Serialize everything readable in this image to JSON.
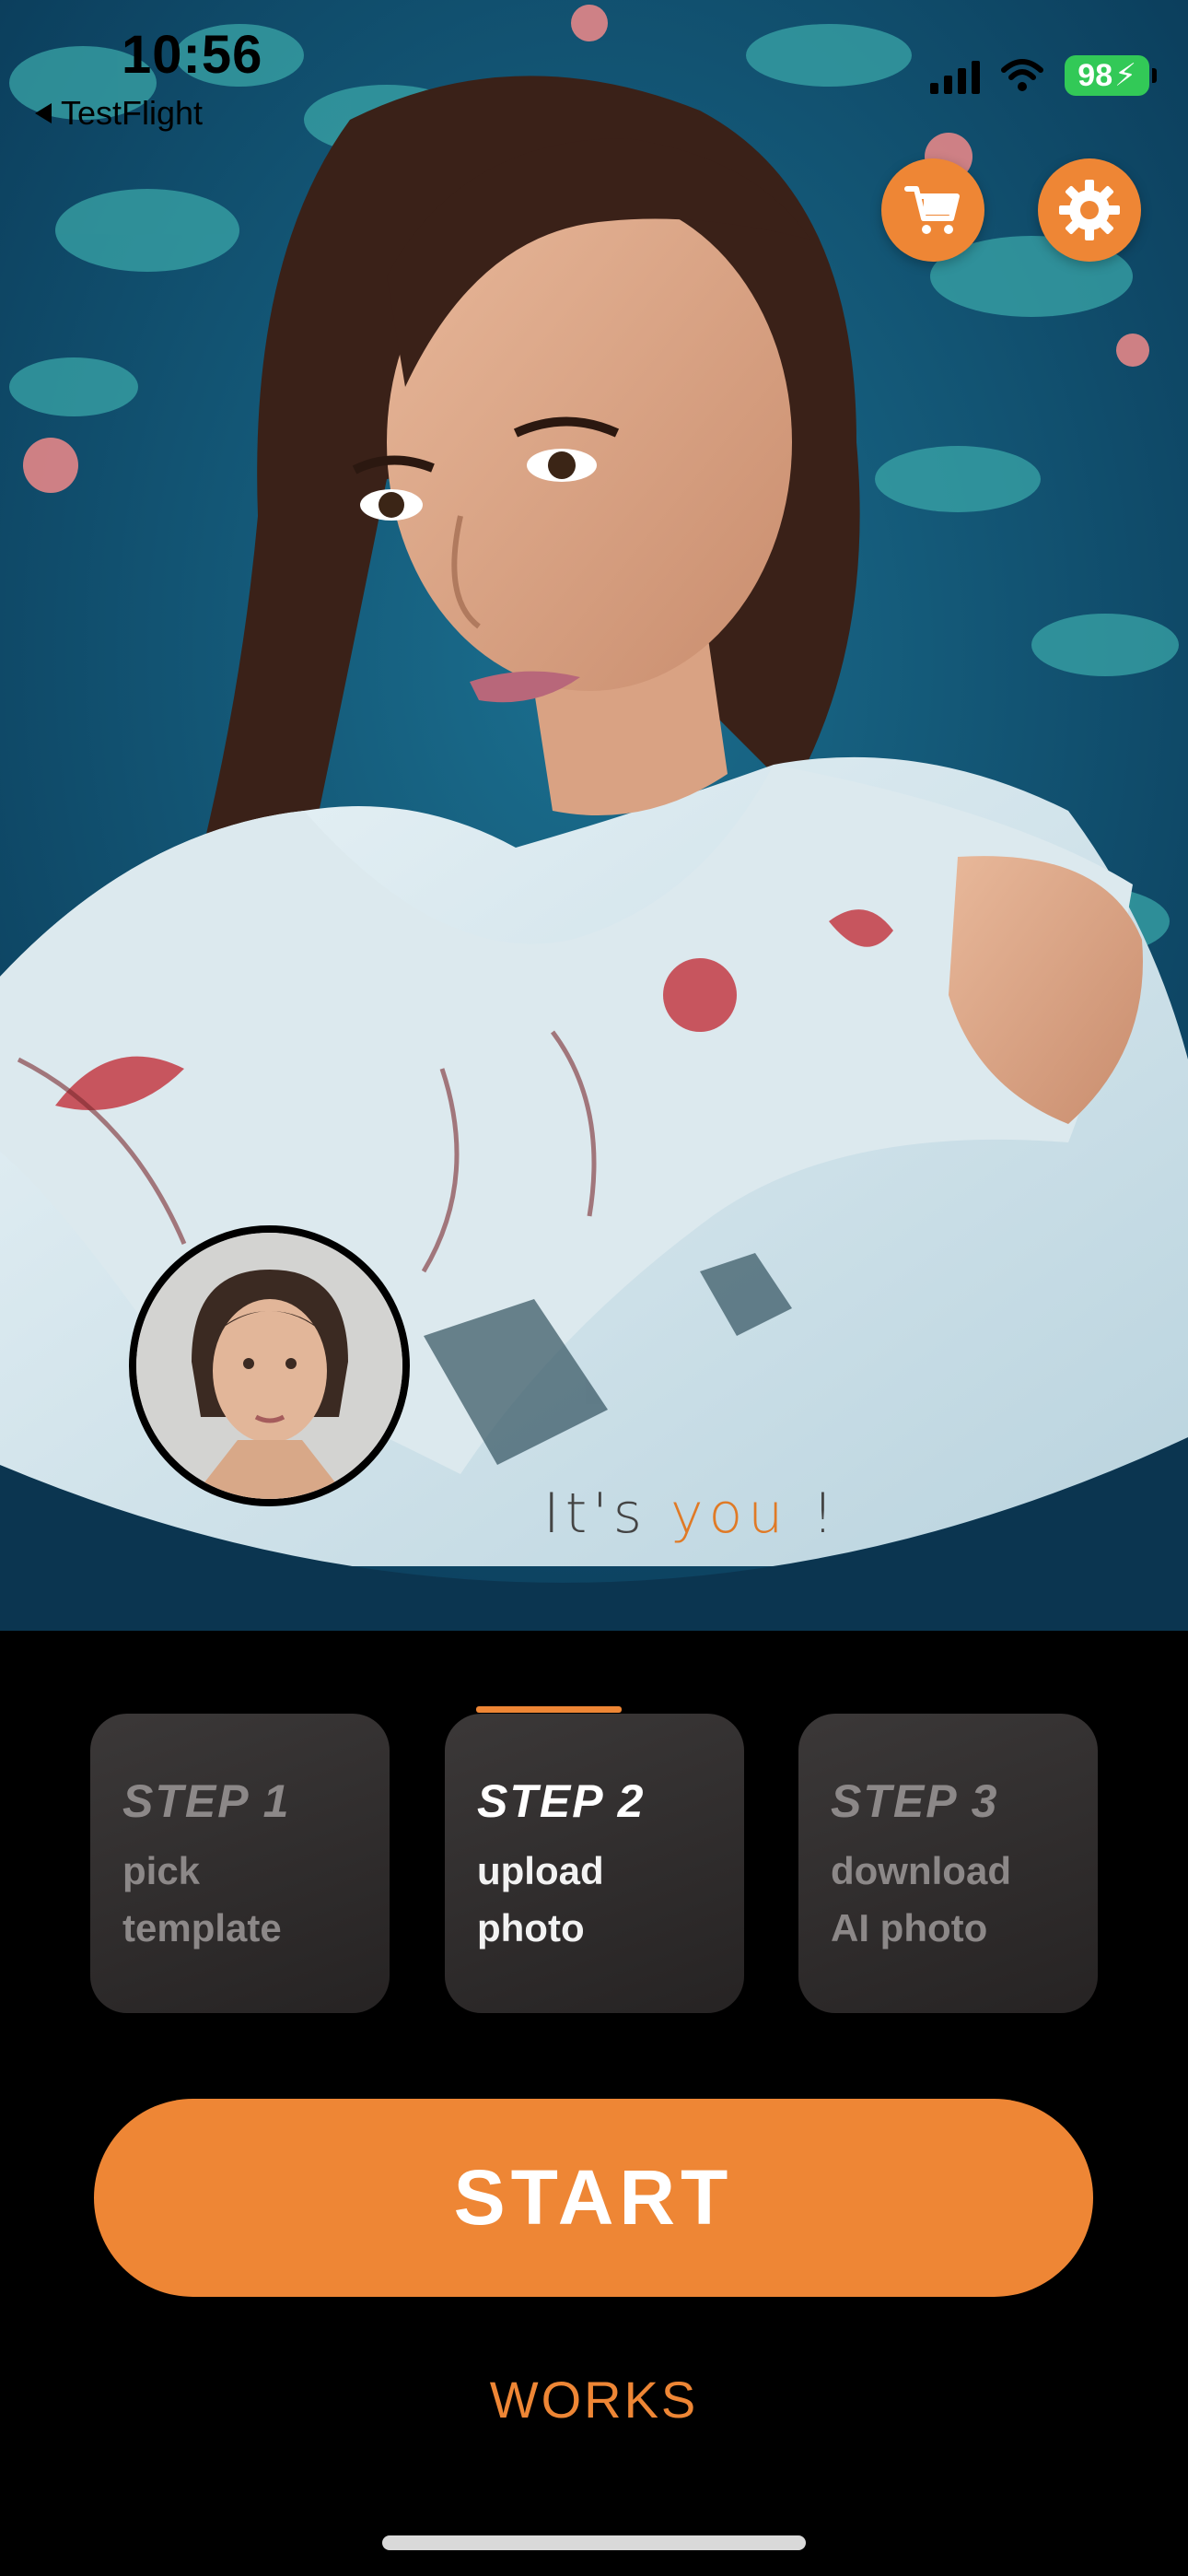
{
  "status_bar": {
    "time": "10:56",
    "back_app": "TestFlight",
    "battery": "98"
  },
  "actions": {
    "cart_icon": "cart-icon",
    "settings_icon": "gear-icon"
  },
  "hero": {
    "tagline_prefix": "It's ",
    "tagline_accent": "you",
    "tagline_suffix": " !"
  },
  "steps": [
    {
      "title": "STEP 1",
      "line1": "pick",
      "line2": "template",
      "active": false
    },
    {
      "title": "STEP 2",
      "line1": "upload",
      "line2": "photo",
      "active": true
    },
    {
      "title": "STEP 3",
      "line1": "download",
      "line2": "AI photo",
      "active": false
    }
  ],
  "start_label": "START",
  "works_label": "WORKS",
  "colors": {
    "accent": "#ee8635",
    "card": "#2f2c2c",
    "background": "#000000",
    "battery": "#32c957"
  }
}
